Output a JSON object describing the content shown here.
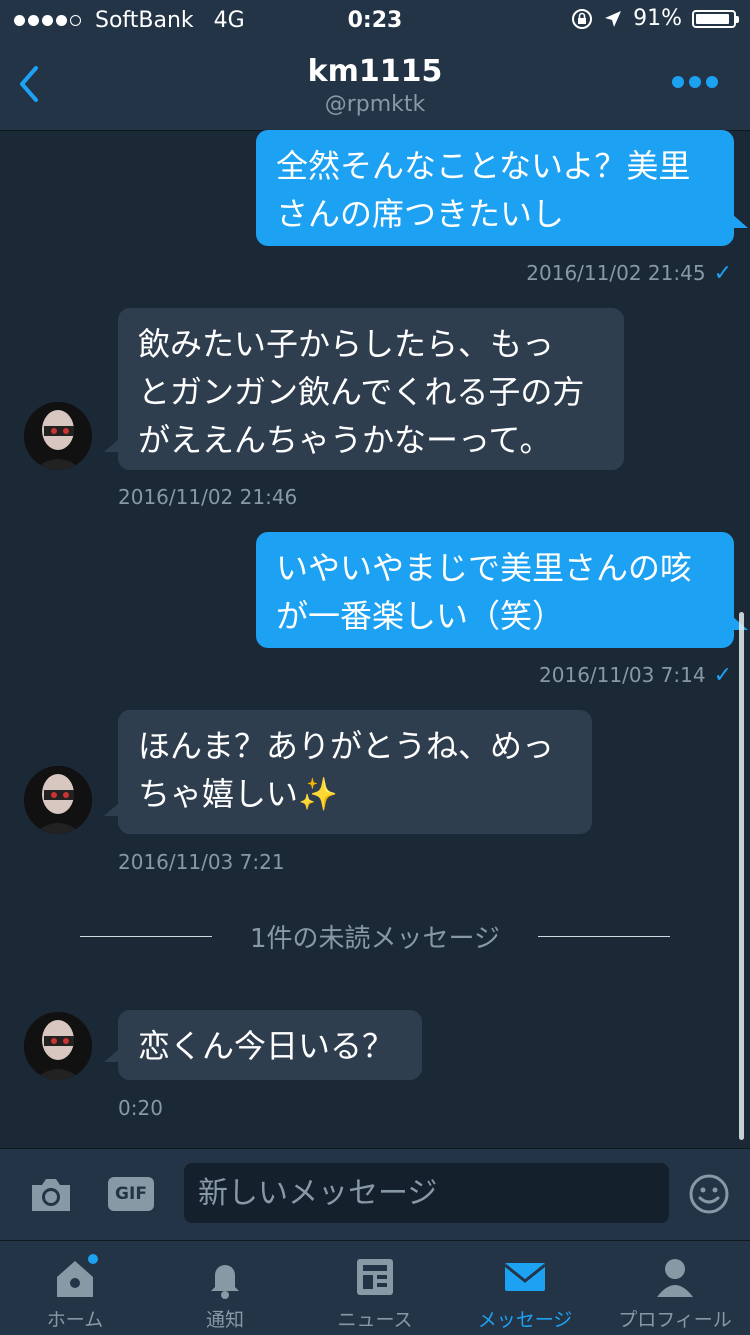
{
  "status": {
    "carrier": "SoftBank",
    "network": "4G",
    "time": "0:23",
    "battery": "91%",
    "battery_level": 0.91
  },
  "header": {
    "title": "km1115",
    "handle": "@rpmktk"
  },
  "messages": [
    {
      "from": "me",
      "lines": [
        "全然そんなことないよ？美里",
        "さんの席つきたいし"
      ],
      "time": "2016/11/02 21:45"
    },
    {
      "from": "them",
      "lines": [
        "飲みたい子からしたら、もっ",
        "とガンガン飲んでくれる子の方",
        "がええんちゃうかなーって。"
      ],
      "time": "2016/11/02 21:46"
    },
    {
      "from": "me",
      "lines": [
        "いやいやまじで美里さんの咳",
        "が一番楽しい（笑）"
      ],
      "time": "2016/11/03 7:14"
    },
    {
      "from": "them",
      "lines": [
        "ほんま？ありがとうね、めっ",
        "ちゃ嬉しい✨"
      ],
      "time": "2016/11/03 7:21"
    },
    {
      "from": "them",
      "lines": [
        "恋くん今日いる？"
      ],
      "time": "0:20"
    }
  ],
  "unread_divider": "1件の未読メッセージ",
  "composer": {
    "placeholder": "新しいメッセージ",
    "gif_label": "GIF"
  },
  "tabs": [
    {
      "label": "ホーム",
      "icon": "home-icon"
    },
    {
      "label": "通知",
      "icon": "bell-icon"
    },
    {
      "label": "ニュース",
      "icon": "news-icon"
    },
    {
      "label": "メッセージ",
      "icon": "mail-icon",
      "active": true
    },
    {
      "label": "プロフィール",
      "icon": "profile-icon"
    }
  ],
  "colors": {
    "accent": "#1da1f2",
    "background": "#1b2836",
    "bar": "#243447",
    "their_bubble": "#2f3e4f"
  }
}
